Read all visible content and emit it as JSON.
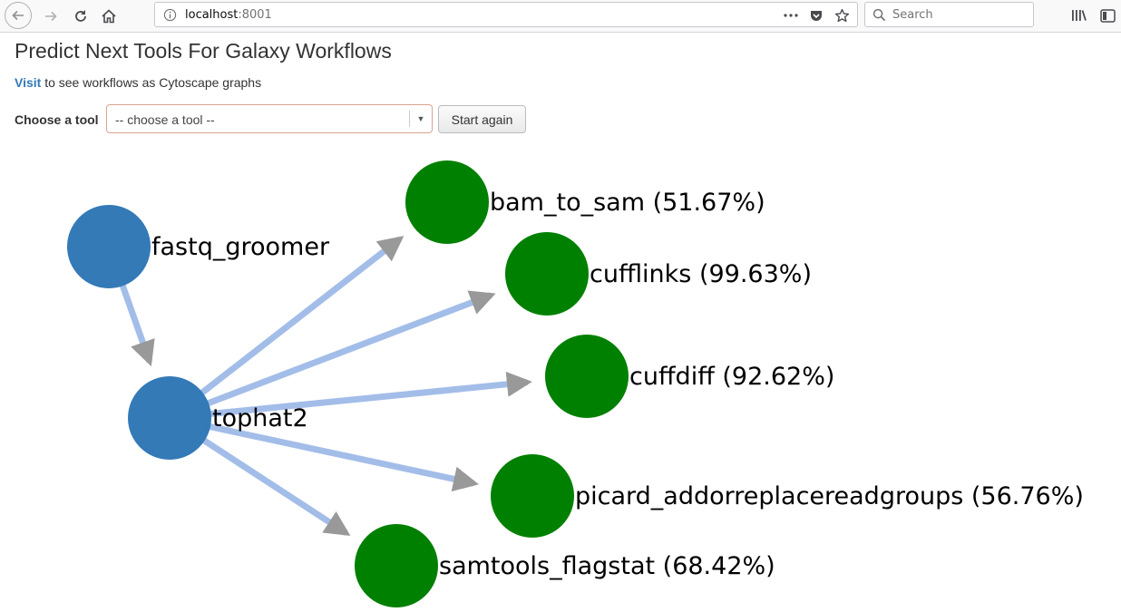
{
  "browser": {
    "url_host": "localhost",
    "url_port": ":8001",
    "search_placeholder": "Search",
    "icons": [
      "back-icon",
      "forward-icon",
      "reload-icon",
      "home-icon",
      "info-icon",
      "more-icon",
      "pocket-icon",
      "bookmark-star-icon",
      "search-icon",
      "library-icon",
      "sidebar-icon"
    ]
  },
  "page": {
    "title": "Predict Next Tools For Galaxy Workflows",
    "visit_link": "Visit",
    "visit_text": " to see workflows as Cytoscape graphs",
    "choose_label": "Choose a tool",
    "select_value": "-- choose a tool --",
    "start_again": "Start again"
  },
  "graph": {
    "colors": {
      "input_node": "#337ab7",
      "predicted_node": "#008000",
      "edge": "#a3bde9",
      "arrow": "#999999"
    },
    "nodes": [
      {
        "id": "fastq_groomer",
        "label": "fastq_groomer",
        "kind": "input"
      },
      {
        "id": "tophat2",
        "label": "tophat2",
        "kind": "input"
      },
      {
        "id": "bam_to_sam",
        "label": "bam_to_sam (51.67%)",
        "kind": "predicted",
        "score": 51.67
      },
      {
        "id": "cufflinks",
        "label": "cufflinks (99.63%)",
        "kind": "predicted",
        "score": 99.63
      },
      {
        "id": "cuffdiff",
        "label": "cuffdiff (92.62%)",
        "kind": "predicted",
        "score": 92.62
      },
      {
        "id": "picard_addorreplacereadgroups",
        "label": "picard_addorreplacereadgroups (56.76%)",
        "kind": "predicted",
        "score": 56.76
      },
      {
        "id": "samtools_flagstat",
        "label": "samtools_flagstat (68.42%)",
        "kind": "predicted",
        "score": 68.42
      }
    ],
    "edges": [
      {
        "from": "fastq_groomer",
        "to": "tophat2"
      },
      {
        "from": "tophat2",
        "to": "bam_to_sam"
      },
      {
        "from": "tophat2",
        "to": "cufflinks"
      },
      {
        "from": "tophat2",
        "to": "cuffdiff"
      },
      {
        "from": "tophat2",
        "to": "picard_addorreplacereadgroups"
      },
      {
        "from": "tophat2",
        "to": "samtools_flagstat"
      }
    ]
  }
}
